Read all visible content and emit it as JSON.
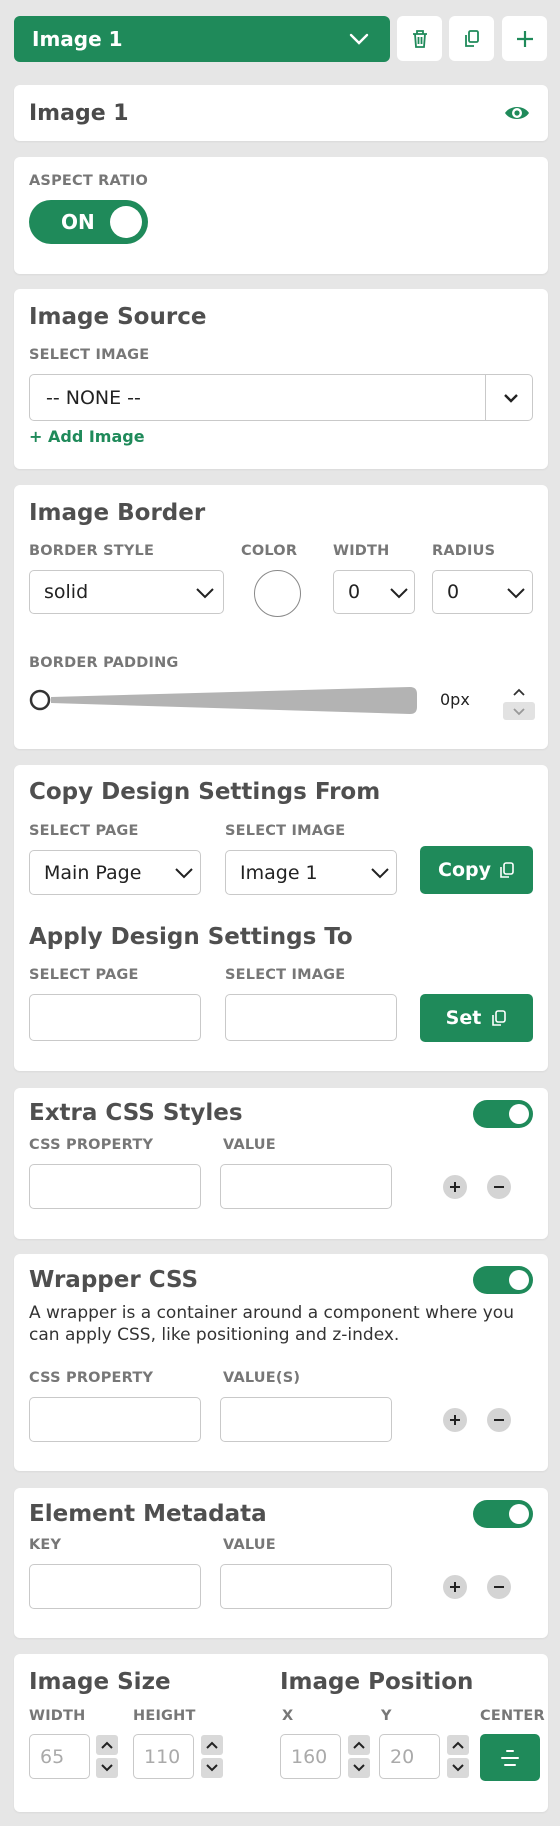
{
  "header": {
    "selector_value": "Image 1",
    "delete_icon": "trash-icon",
    "copy_icon": "copy-icon",
    "add_icon": "plus-icon"
  },
  "name_card": {
    "name": "Image 1",
    "visibility_icon": "eye-icon"
  },
  "aspect_ratio": {
    "label": "ASPECT RATIO",
    "toggle_text": "ON"
  },
  "image_source": {
    "title": "Image Source",
    "select_label": "SELECT IMAGE",
    "select_value": "-- NONE --",
    "add_link": "+ Add Image"
  },
  "image_border": {
    "title": "Image Border",
    "style_label": "BORDER STYLE",
    "style_value": "solid",
    "color_label": "COLOR",
    "width_label": "WIDTH",
    "width_value": "0",
    "radius_label": "RADIUS",
    "radius_value": "0",
    "padding_label": "BORDER PADDING",
    "padding_value": "0px"
  },
  "copy_design": {
    "title": "Copy Design Settings From",
    "page_label": "SELECT PAGE",
    "page_value": "Main Page",
    "image_label": "SELECT IMAGE",
    "image_value": "Image 1",
    "button_label": "Copy"
  },
  "apply_design": {
    "title": "Apply Design Settings To",
    "page_label": "SELECT PAGE",
    "image_label": "SELECT IMAGE",
    "button_label": "Set"
  },
  "extra_css": {
    "title": "Extra CSS Styles",
    "property_label": "CSS PROPERTY",
    "value_label": "VALUE"
  },
  "wrapper_css": {
    "title": "Wrapper CSS",
    "description": "A wrapper is a container around a component where you can apply CSS, like positioning and z-index.",
    "property_label": "CSS PROPERTY",
    "value_label": "VALUE(S)"
  },
  "metadata": {
    "title": "Element Metadata",
    "key_label": "KEY",
    "value_label": "VALUE"
  },
  "size": {
    "title": "Image Size",
    "width_label": "WIDTH",
    "width_value": "65",
    "height_label": "HEIGHT",
    "height_value": "110"
  },
  "position": {
    "title": "Image Position",
    "x_label": "X",
    "x_value": "160",
    "y_label": "Y",
    "y_value": "20",
    "center_label": "CENTER"
  },
  "colors": {
    "accent": "#1f8a5a",
    "background": "#e6e6e6"
  }
}
